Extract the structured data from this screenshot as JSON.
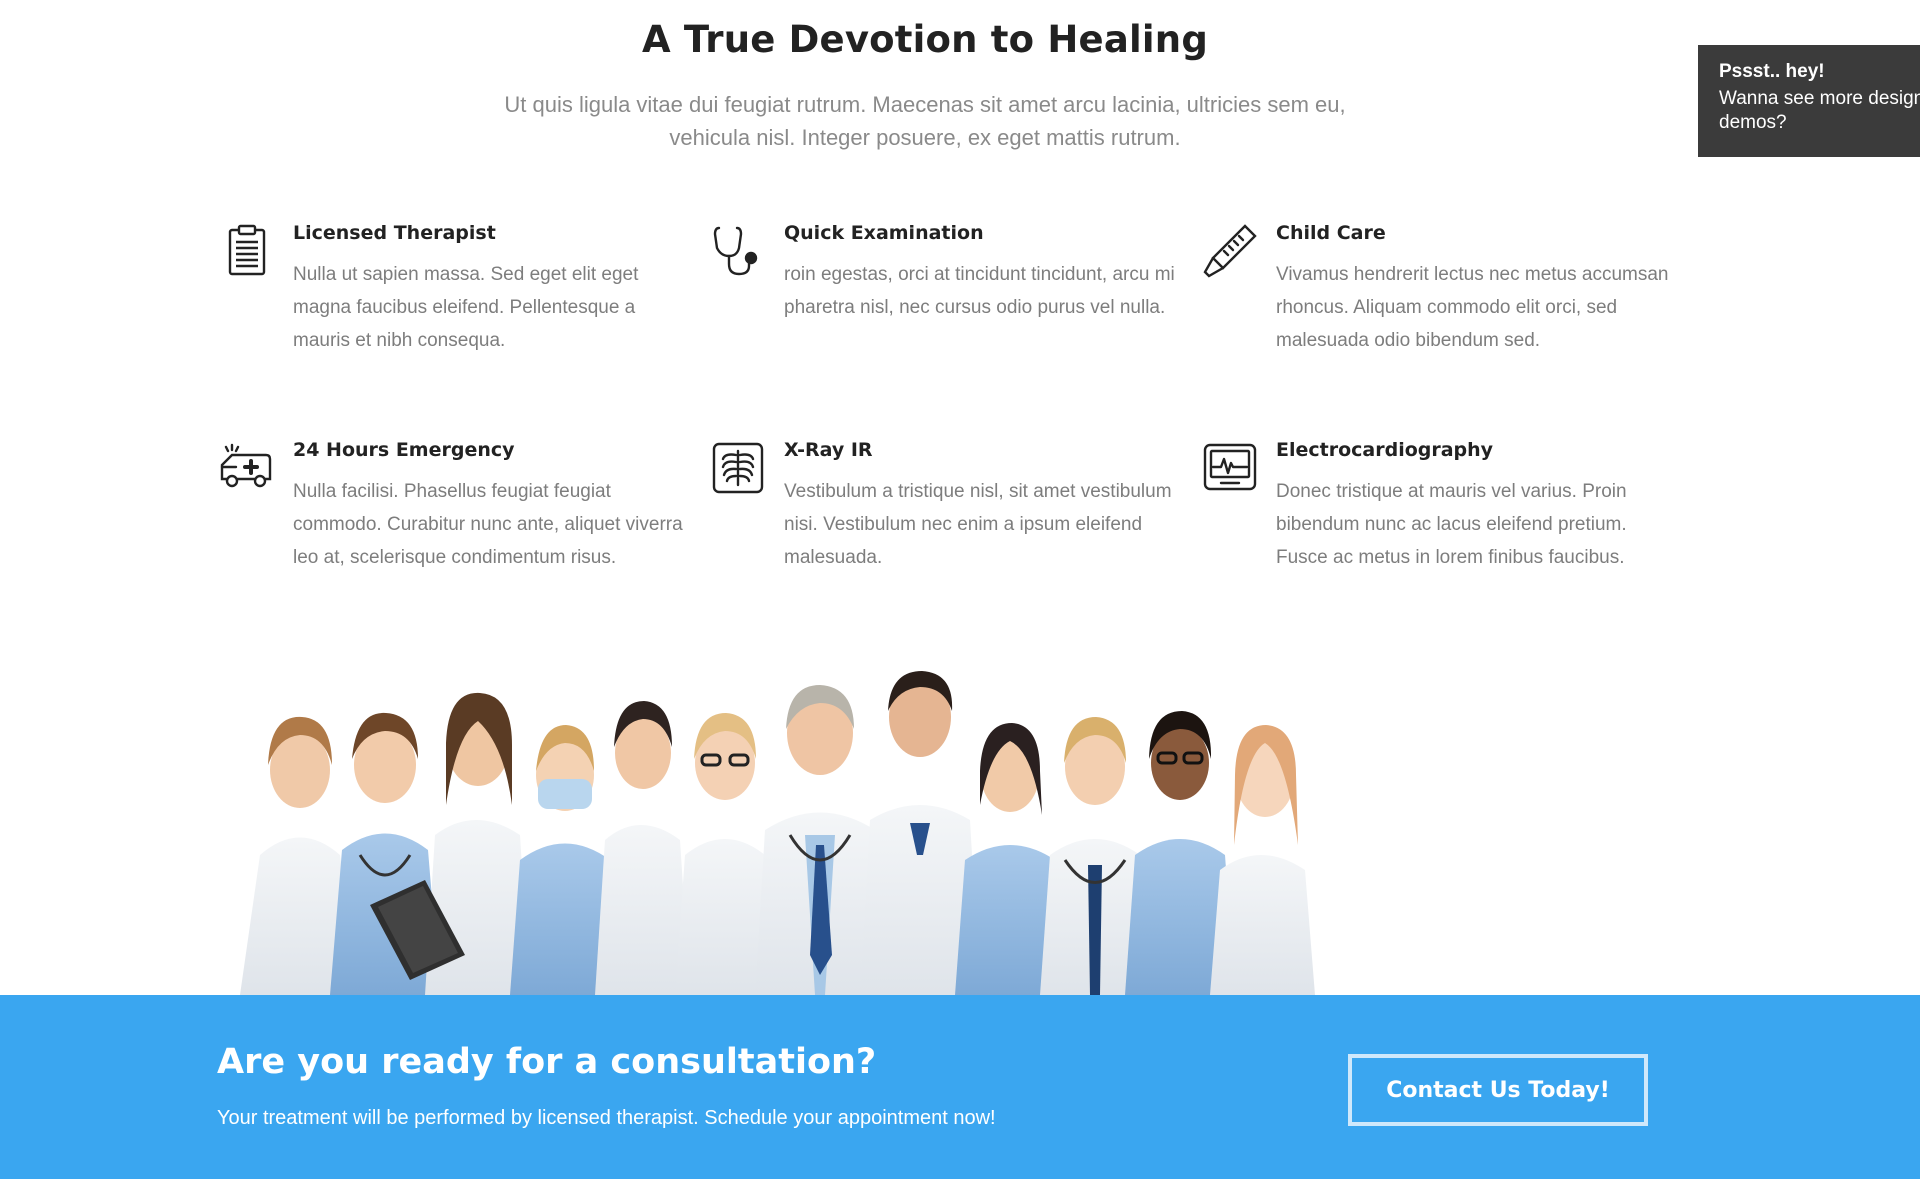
{
  "section": {
    "title": "A True Devotion to Healing",
    "subtitle": "Ut quis ligula vitae dui feugiat rutrum. Maecenas sit amet arcu lacinia, ultricies sem eu, vehicula nisl. Integer posuere, ex eget mattis rutrum."
  },
  "features": [
    {
      "icon": "clipboard-icon",
      "title": "Licensed Therapist",
      "text": "Nulla ut sapien massa. Sed eget elit eget magna faucibus eleifend. Pellentesque a mauris et nibh consequa."
    },
    {
      "icon": "stethoscope-icon",
      "title": "Quick Examination",
      "text": "roin egestas, orci at tincidunt tincidunt, arcu mi pharetra nisl, nec cursus odio purus vel nulla."
    },
    {
      "icon": "thermometer-icon",
      "title": "Child Care",
      "text": "Vivamus hendrerit lectus nec metus accumsan rhoncus. Aliquam commodo elit orci, sed malesuada odio bibendum sed."
    },
    {
      "icon": "ambulance-icon",
      "title": "24 Hours Emergency",
      "text": "Nulla facilisi. Phasellus feugiat feugiat commodo. Curabitur nunc ante, aliquet viverra leo at, scelerisque condimentum risus."
    },
    {
      "icon": "xray-icon",
      "title": "X-Ray IR",
      "text": "Vestibulum a tristique nisl, sit amet vestibulum nisi. Vestibulum nec enim a ipsum eleifend malesuada."
    },
    {
      "icon": "ecg-monitor-icon",
      "title": "Electrocardiography",
      "text": "Donec tristique at mauris vel varius. Proin bibendum nunc ac lacus eleifend pretium. Fusce ac metus in lorem finibus faucibus."
    }
  ],
  "cta": {
    "title": "Are you ready for a consultation?",
    "text": "Your treatment will be performed by licensed therapist. Schedule your appointment now!",
    "button_label": "Contact Us Today!",
    "background_color": "#3aa6f0"
  },
  "promo": {
    "heading": "Pssst.. hey!",
    "body": "Wanna see more designs and demos?"
  }
}
